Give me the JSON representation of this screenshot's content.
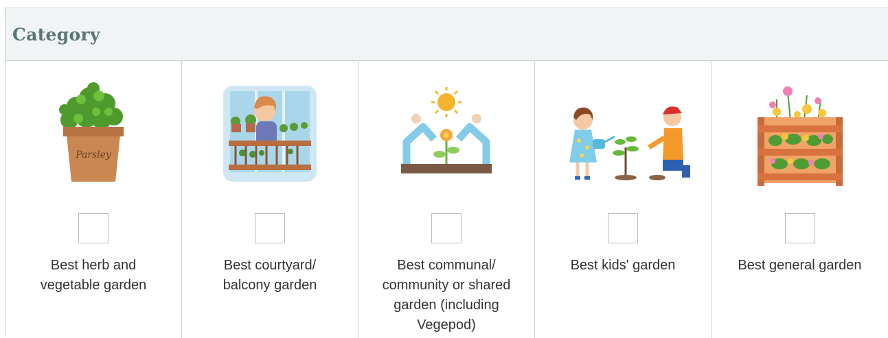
{
  "header": {
    "title": "Category"
  },
  "categories": [
    {
      "label": "Best herb and\nvegetable garden",
      "icon": "parsley-pot-icon",
      "pot_text": "Parsley"
    },
    {
      "label": "Best courtyard/\nbalcony garden",
      "icon": "balcony-gardener-icon"
    },
    {
      "label": "Best communal/\ncommunity or shared\ngarden (including\nVegepod)",
      "icon": "community-garden-icon"
    },
    {
      "label": "Best kids' garden",
      "icon": "kids-planting-icon"
    },
    {
      "label": "Best general garden",
      "icon": "flower-planter-icon"
    }
  ],
  "colors": {
    "header_bg": "#f1f4f4",
    "header_text": "#5a7579",
    "border": "#c9d1d3"
  }
}
